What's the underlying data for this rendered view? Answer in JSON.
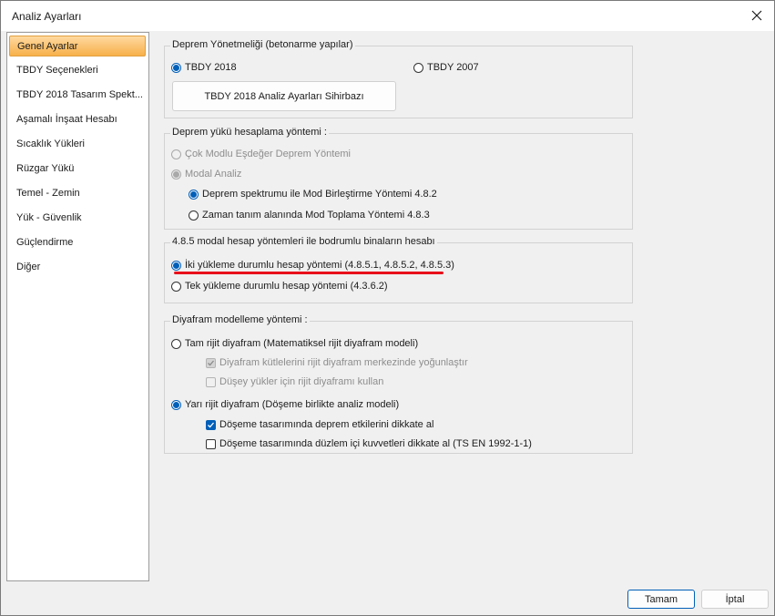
{
  "window": {
    "title": "Analiz Ayarları"
  },
  "nav": {
    "items": [
      {
        "label": "Genel Ayarlar"
      },
      {
        "label": "TBDY Seçenekleri"
      },
      {
        "label": "TBDY 2018 Tasarım Spekt..."
      },
      {
        "label": "Aşamalı İnşaat Hesabı"
      },
      {
        "label": "Sıcaklık Yükleri"
      },
      {
        "label": "Rüzgar Yükü"
      },
      {
        "label": "Temel - Zemin"
      },
      {
        "label": "Yük - Güvenlik"
      },
      {
        "label": "Güçlendirme"
      },
      {
        "label": "Diğer"
      }
    ]
  },
  "seismic_code": {
    "title": "Deprem Yönetmeliği (betonarme yapılar)",
    "opt_2018": "TBDY 2018",
    "opt_2007": "TBDY 2007",
    "wizard_button": "TBDY 2018 Analiz Ayarları Sihirbazı"
  },
  "seismic_method": {
    "title": "Deprem yükü hesaplama yöntemi :",
    "opt_multi_mode": "Çok Modlu Eşdeğer Deprem Yöntemi",
    "opt_modal": "Modal Analiz",
    "opt_spectrum": "Deprem spektrumu ile Mod Birleştirme Yöntemi 4.8.2",
    "opt_time": "Zaman tanım alanında Mod Toplama Yöntemi 4.8.3"
  },
  "basement": {
    "title": "4.8.5 modal hesap yöntemleri ile bodrumlu binaların hesabı",
    "opt_two": "İki yükleme durumlu hesap yöntemi (4.8.5.1, 4.8.5.2, 4.8.5.3)",
    "opt_single": "Tek yükleme durumlu hesap yöntemi (4.3.6.2)"
  },
  "diaphragm": {
    "title": "Diyafram modelleme yöntemi  :",
    "opt_rigid": "Tam rijit diyafram (Matematiksel rijit diyafram modeli)",
    "chk_mass_center": "Diyafram kütlelerini rijit diyafram merkezinde yoğunlaştır",
    "chk_vertical": "Düşey yükler için rijit diyaframı kullan",
    "opt_semi": "Yarı rijit diyafram (Döşeme birlikte analiz modeli)",
    "chk_slab_seismic": "Döşeme tasarımında deprem etkilerini dikkate al",
    "chk_slab_inplane": "Döşeme tasarımında düzlem içi kuvvetleri dikkate al (TS EN 1992-1-1)"
  },
  "footer": {
    "ok_label": "Tamam",
    "cancel_label": "İptal"
  },
  "colors": {
    "accent": "#005fb8",
    "highlight": "#f7b04a",
    "annotation": "#e8101a"
  }
}
